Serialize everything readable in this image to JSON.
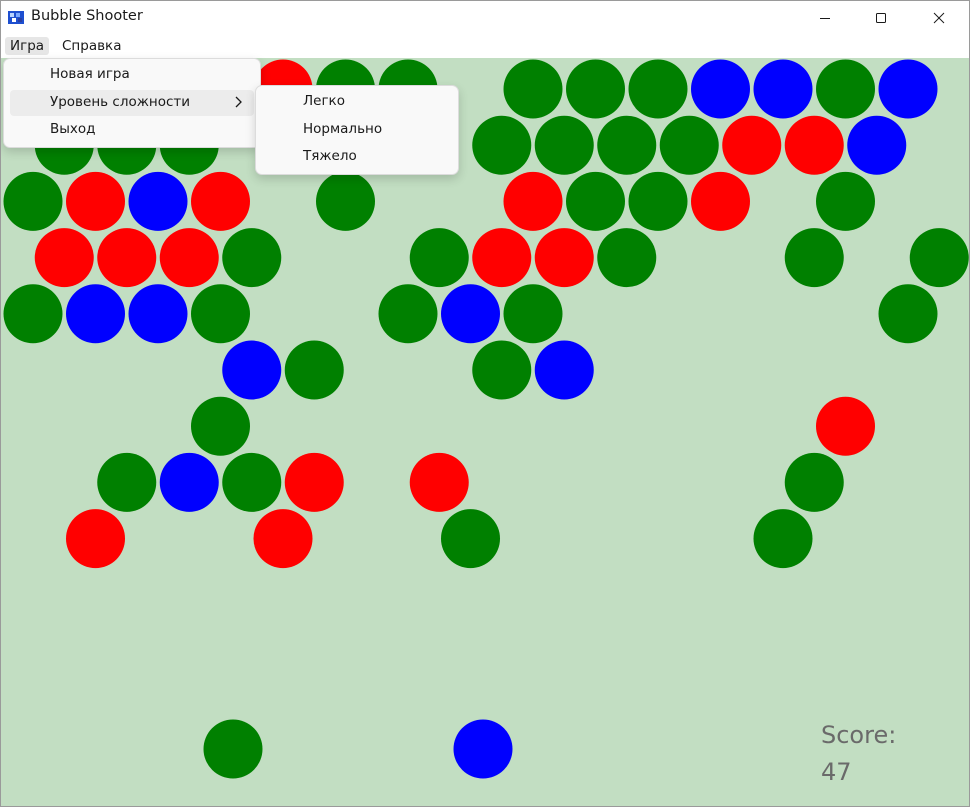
{
  "window": {
    "title": "Bubble Shooter",
    "app_icon": "app-icon",
    "controls": [
      "minimize-icon",
      "maximize-icon",
      "close-icon"
    ]
  },
  "menubar": {
    "game": "Игра",
    "help": "Справка"
  },
  "game_menu": {
    "items": [
      {
        "label": "Новая игра"
      },
      {
        "label": "Уровень сложности",
        "has_submenu": true
      },
      {
        "label": "Выход"
      }
    ]
  },
  "difficulty_menu": {
    "items": [
      {
        "label": "Легко"
      },
      {
        "label": "Нормально"
      },
      {
        "label": "Тяжело"
      }
    ]
  },
  "score": {
    "label": "Score:",
    "value": "47"
  },
  "colors": {
    "green": "#008000",
    "red": "#ff0000",
    "blue": "#0000ff",
    "board_background": "#c2dec2"
  },
  "bubble_rows": [
    [
      "empty",
      "empty",
      "empty",
      "empty",
      "red",
      "green",
      "green",
      "empty",
      "green",
      "green",
      "green",
      "blue",
      "blue",
      "green",
      "blue"
    ],
    [
      "green",
      "green",
      "green",
      "empty",
      "empty",
      "empty",
      "empty",
      "green",
      "green",
      "green",
      "green",
      "red",
      "red",
      "blue",
      "empty"
    ],
    [
      "green",
      "red",
      "blue",
      "red",
      "empty",
      "green",
      "empty",
      "empty",
      "red",
      "green",
      "green",
      "red",
      "empty",
      "green",
      "empty",
      "empty"
    ],
    [
      "red",
      "red",
      "red",
      "green",
      "empty",
      "empty",
      "green",
      "red",
      "red",
      "green",
      "empty",
      "empty",
      "green",
      "empty",
      "green"
    ],
    [
      "green",
      "blue",
      "blue",
      "green",
      "empty",
      "empty",
      "green",
      "blue",
      "green",
      "empty",
      "empty",
      "empty",
      "empty",
      "empty",
      "green",
      "empty"
    ],
    [
      "empty",
      "empty",
      "empty",
      "blue",
      "green",
      "empty",
      "empty",
      "green",
      "blue",
      "empty",
      "empty",
      "empty",
      "empty",
      "empty",
      "empty"
    ],
    [
      "empty",
      "empty",
      "empty",
      "green",
      "empty",
      "empty",
      "empty",
      "empty",
      "empty",
      "empty",
      "empty",
      "empty",
      "empty",
      "red",
      "empty",
      "empty"
    ],
    [
      "empty",
      "green",
      "blue",
      "green",
      "red",
      "empty",
      "red",
      "empty",
      "empty",
      "empty",
      "empty",
      "empty",
      "green",
      "empty",
      "empty"
    ],
    [
      "empty",
      "red",
      "empty",
      "empty",
      "red",
      "empty",
      "empty",
      "green",
      "empty",
      "empty",
      "empty",
      "empty",
      "green",
      "empty",
      "empty",
      "empty"
    ]
  ],
  "shooter": {
    "current": "green",
    "next": "blue"
  }
}
